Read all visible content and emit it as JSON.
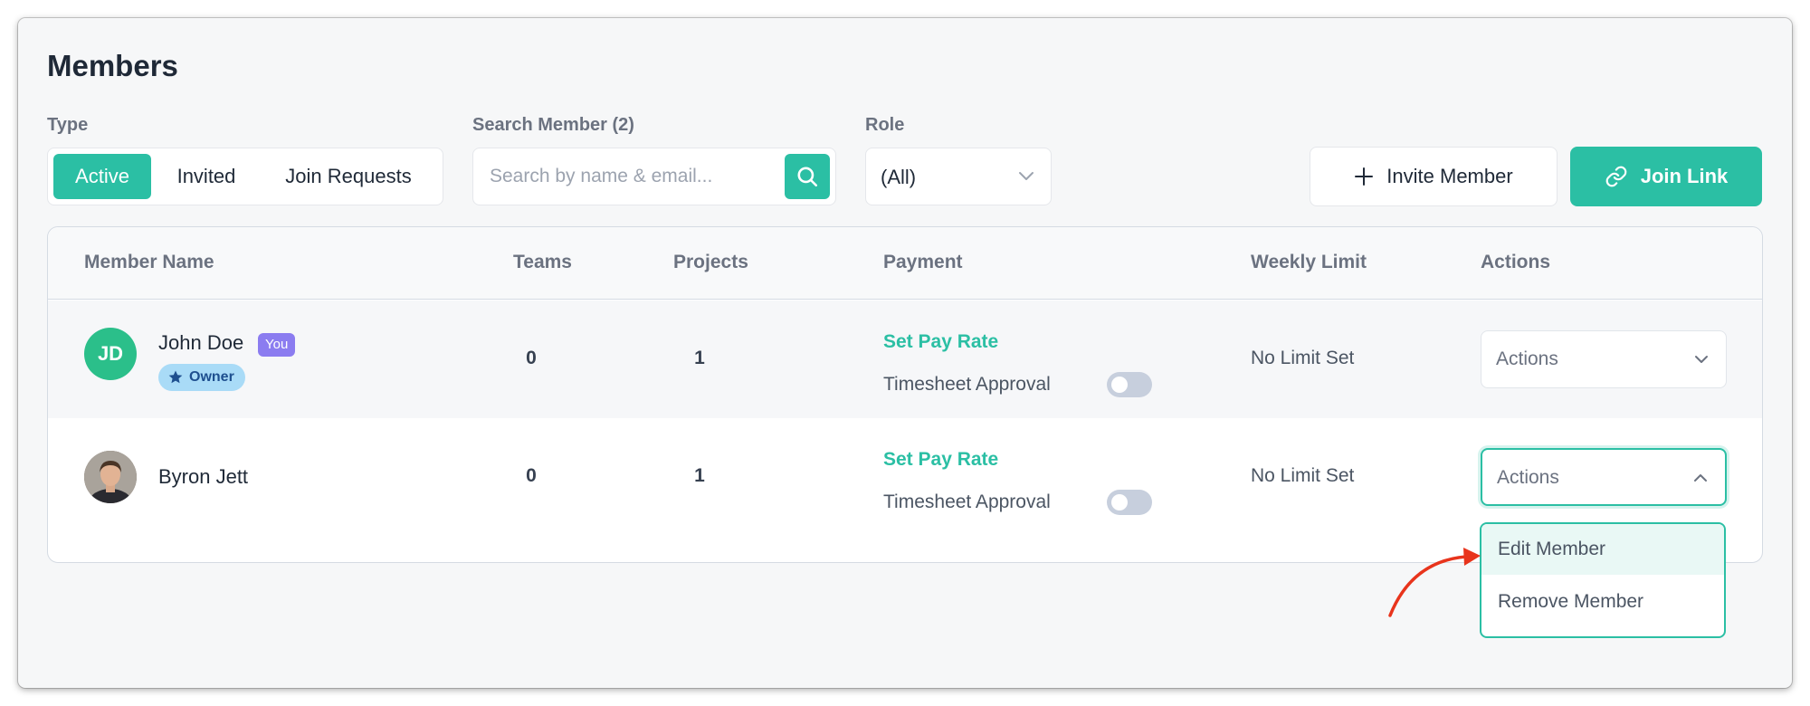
{
  "page": {
    "title": "Members"
  },
  "filters": {
    "type_label": "Type",
    "type_options": [
      "Active",
      "Invited",
      "Join Requests"
    ],
    "search_label": "Search Member (2)",
    "search_placeholder": "Search by name & email...",
    "role_label": "Role",
    "role_value": "(All)"
  },
  "buttons": {
    "invite": "Invite Member",
    "join_link": "Join Link"
  },
  "table": {
    "columns": [
      "Member Name",
      "Teams",
      "Projects",
      "Payment",
      "Weekly Limit",
      "Actions"
    ],
    "rows": [
      {
        "initials": "JD",
        "name": "John Doe",
        "you_badge": "You",
        "role_badge": "Owner",
        "teams": "0",
        "projects": "1",
        "pay_rate": "Set Pay Rate",
        "timesheet": "Timesheet Approval",
        "weekly_limit": "No Limit Set",
        "actions": "Actions"
      },
      {
        "name": "Byron Jett",
        "teams": "0",
        "projects": "1",
        "pay_rate": "Set Pay Rate",
        "timesheet": "Timesheet Approval",
        "weekly_limit": "No Limit Set",
        "actions": "Actions"
      }
    ]
  },
  "dropdown": {
    "items": [
      "Edit Member",
      "Remove Member"
    ]
  },
  "colors": {
    "accent": "#2bbfa4",
    "you_badge": "#8b7cf0",
    "owner_badge": "#a9dbf7",
    "arrow": "#e8341c"
  }
}
